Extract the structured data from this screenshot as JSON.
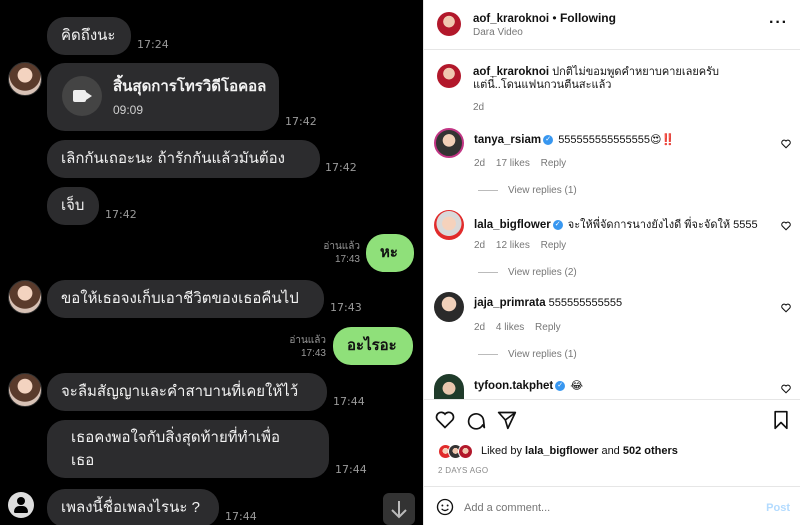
{
  "chat": {
    "messages": [
      {
        "text": "คิดถึงนะ",
        "time": "17:24"
      },
      {
        "call_title": "สิ้นสุดการโทรวิดีโอคอล",
        "call_duration": "09:09",
        "time": "17:42"
      },
      {
        "text": "เลิกกันเถอะนะ ถ้ารักกันแล้วมันต้อง",
        "time": "17:42"
      },
      {
        "text": "เจ็บ",
        "time": "17:42"
      },
      {
        "text": "หะ",
        "time": "17:43",
        "read": "อ่านแล้ว"
      },
      {
        "text": "ขอให้เธอจงเก็บเอาชีวิตของเธอคืนไป",
        "time": "17:43"
      },
      {
        "text": "อะไรอะ",
        "time": "17:43",
        "read": "อ่านแล้ว"
      },
      {
        "text": "จะลืมสัญญาและคำสาบานที่เคยให้ไว้",
        "time": "17:44"
      },
      {
        "text_line1": "เธอคงพอใจกับสิ่งสุดท้ายที่ทำเพื่อ",
        "text_line2": "เธอ",
        "time": "17:44"
      },
      {
        "text": "เพลงนี้ชื่อเพลงไรนะ ?",
        "time": "17:44"
      }
    ]
  },
  "post": {
    "author": "aof_kraroknoi",
    "follow": "Following",
    "subtitle": "Dara Video",
    "caption_line1": "ปกติไม่ขอมพูดคำหยาบคายเลยครับ",
    "caption_line2": "แต่นี่..โดนแฟนกวนตีนสะแล้ว",
    "caption_age": "2d"
  },
  "comments": [
    {
      "user": "tanya_rsiam",
      "text": "555555555555555😍‼️",
      "age": "2d",
      "likes": "17 likes",
      "reply": "Reply",
      "view": "View replies (1)"
    },
    {
      "user": "lala_bigflower",
      "text": "จะให้พี่จัดการนางยังไงดี พี่จะจัดให้ 5555",
      "age": "2d",
      "likes": "12 likes",
      "reply": "Reply",
      "view": "View replies (2)"
    },
    {
      "user": "jaja_primrata",
      "text": "555555555555",
      "age": "2d",
      "likes": "4 likes",
      "reply": "Reply",
      "view": "View replies (1)"
    },
    {
      "user": "tyfoon.takphet",
      "text": "😂"
    }
  ],
  "footer": {
    "liked_prefix": "Liked by ",
    "liked_user": "lala_bigflower",
    "liked_mid": " and ",
    "liked_count": "502 others",
    "date": "2 DAYS AGO",
    "comment_placeholder": "Add a comment...",
    "post_label": "Post"
  }
}
